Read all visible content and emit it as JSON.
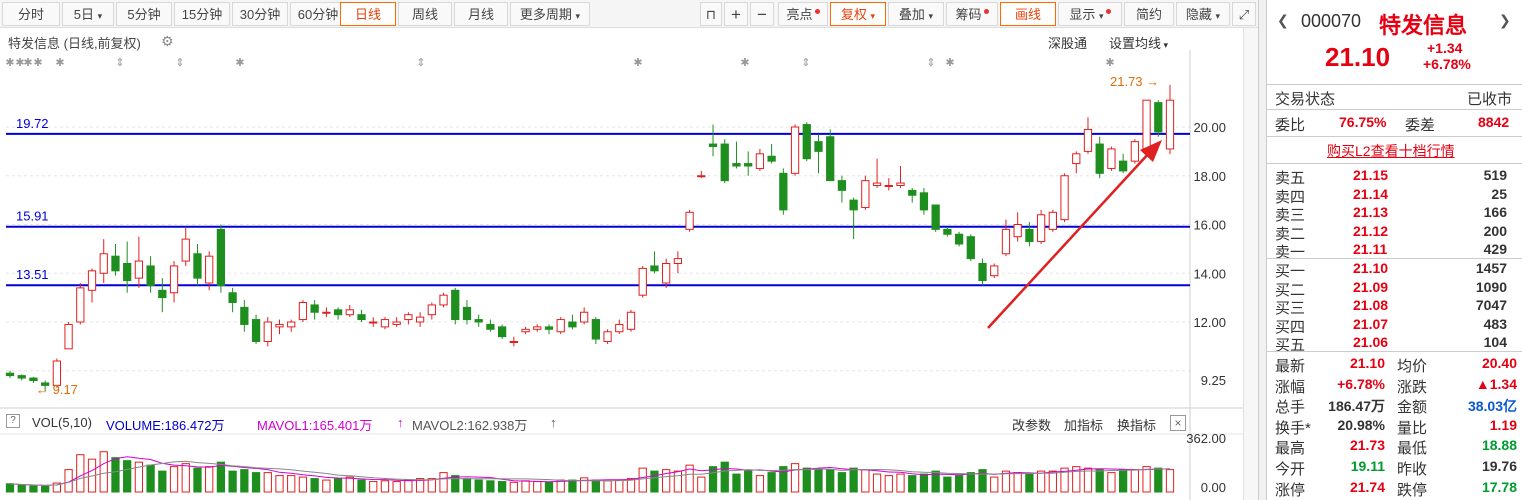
{
  "toolbar": {
    "periods": [
      "分时",
      "5日",
      "5分钟",
      "15分钟",
      "30分钟",
      "60分钟",
      "日线",
      "周线",
      "月线",
      "更多周期"
    ],
    "active_period": "日线",
    "right_tools": [
      "亮点",
      "复权",
      "叠加",
      "筹码",
      "画线",
      "显示",
      "简约",
      "隐藏"
    ]
  },
  "chart": {
    "title": "特发信息 (日线,前复权)",
    "link_sgt": "深股通",
    "link_ma": "设置均线",
    "y_axis_labels": [
      "20.00",
      "18.00",
      "16.00",
      "14.00",
      "12.00"
    ],
    "hlines": [
      {
        "label": "19.72",
        "value": 19.72
      },
      {
        "label": "15.91",
        "value": 15.91
      },
      {
        "label": "13.51",
        "value": 13.51
      }
    ],
    "high_marker": "21.73",
    "low_marker": "9.17",
    "cursor_value": "9.25",
    "colors": {
      "up": "#e02020",
      "down": "#1e8e1e",
      "hline": "#0000dd",
      "arrow": "#e02020",
      "marker": "#e36c09"
    }
  },
  "volume": {
    "indicator": "VOL(5,10)",
    "volume": "VOLUME:186.472万",
    "mavol1": "MAVOL1:165.401万",
    "mavol2": "MAVOL2:162.938万",
    "buttons": [
      "改参数",
      "加指标",
      "换指标"
    ],
    "axis_top": "362.00",
    "axis_bottom": "0.00"
  },
  "quote": {
    "code": "000070",
    "name": "特发信息",
    "price": "21.10",
    "change": "+1.34",
    "change_pct": "+6.78%",
    "status_label": "交易状态",
    "status_value": "已收市",
    "weibi_label": "委比",
    "weibi": "76.75%",
    "weicha_label": "委差",
    "weicha": "8842",
    "l2_link": "购买L2查看十档行情",
    "asks": [
      {
        "label": "卖五",
        "price": "21.15",
        "vol": "519"
      },
      {
        "label": "卖四",
        "price": "21.14",
        "vol": "25"
      },
      {
        "label": "卖三",
        "price": "21.13",
        "vol": "166"
      },
      {
        "label": "卖二",
        "price": "21.12",
        "vol": "200"
      },
      {
        "label": "卖一",
        "price": "21.11",
        "vol": "429"
      }
    ],
    "bids": [
      {
        "label": "买一",
        "price": "21.10",
        "vol": "1457"
      },
      {
        "label": "买二",
        "price": "21.09",
        "vol": "1090"
      },
      {
        "label": "买三",
        "price": "21.08",
        "vol": "7047"
      },
      {
        "label": "买四",
        "price": "21.07",
        "vol": "483"
      },
      {
        "label": "买五",
        "price": "21.06",
        "vol": "104"
      }
    ],
    "stats": [
      {
        "l1": "最新",
        "v1": "21.10",
        "c1": "red",
        "l2": "均价",
        "v2": "20.40",
        "c2": "red"
      },
      {
        "l1": "涨幅",
        "v1": "+6.78%",
        "c1": "red",
        "l2": "涨跌",
        "v2": "▲1.34",
        "c2": "red"
      },
      {
        "l1": "总手",
        "v1": "186.47万",
        "c1": "black",
        "l2": "金额",
        "v2": "38.03亿",
        "c2": "blue"
      },
      {
        "l1": "换手*",
        "v1": "20.98%",
        "c1": "black",
        "l2": "量比",
        "v2": "1.19",
        "c2": "red"
      },
      {
        "l1": "最高",
        "v1": "21.73",
        "c1": "red",
        "l2": "最低",
        "v2": "18.88",
        "c2": "green"
      },
      {
        "l1": "今开",
        "v1": "19.11",
        "c1": "green",
        "l2": "昨收",
        "v2": "19.76",
        "c2": "black"
      },
      {
        "l1": "涨停",
        "v1": "21.74",
        "c1": "red",
        "l2": "跌停",
        "v2": "17.78",
        "c2": "green"
      }
    ]
  },
  "candles": [
    [
      9.9,
      10.0,
      9.7,
      9.8
    ],
    [
      9.8,
      9.85,
      9.6,
      9.7
    ],
    [
      9.7,
      9.75,
      9.5,
      9.6
    ],
    [
      9.5,
      9.6,
      9.17,
      9.4
    ],
    [
      9.4,
      10.5,
      9.3,
      10.4
    ],
    [
      10.9,
      12.0,
      10.9,
      11.9
    ],
    [
      12.0,
      13.6,
      11.9,
      13.4
    ],
    [
      13.3,
      14.2,
      12.8,
      14.1
    ],
    [
      14.0,
      15.4,
      13.6,
      14.8
    ],
    [
      14.7,
      15.2,
      13.9,
      14.1
    ],
    [
      14.4,
      15.3,
      13.2,
      13.7
    ],
    [
      13.8,
      15.5,
      13.4,
      14.5
    ],
    [
      14.3,
      14.7,
      13.2,
      13.5
    ],
    [
      13.3,
      13.8,
      12.4,
      13.0
    ],
    [
      13.2,
      14.5,
      12.8,
      14.3
    ],
    [
      14.5,
      15.9,
      14.3,
      15.4
    ],
    [
      14.8,
      15.2,
      13.5,
      13.8
    ],
    [
      13.6,
      14.9,
      13.3,
      14.7
    ],
    [
      15.8,
      16.0,
      13.2,
      13.5
    ],
    [
      13.2,
      13.4,
      12.4,
      12.8
    ],
    [
      12.6,
      12.9,
      11.6,
      11.9
    ],
    [
      12.1,
      12.3,
      11.1,
      11.2
    ],
    [
      11.2,
      12.2,
      11.0,
      12.0
    ],
    [
      11.8,
      12.1,
      11.5,
      11.9
    ],
    [
      11.8,
      12.1,
      11.6,
      12.0
    ],
    [
      12.1,
      12.9,
      12.0,
      12.8
    ],
    [
      12.7,
      12.9,
      12.1,
      12.4
    ],
    [
      12.4,
      12.6,
      12.2,
      12.4
    ],
    [
      12.5,
      12.6,
      12.1,
      12.3
    ],
    [
      12.3,
      12.7,
      12.2,
      12.5
    ],
    [
      12.3,
      12.5,
      12.0,
      12.1
    ],
    [
      12.0,
      12.2,
      11.8,
      12.0
    ],
    [
      11.8,
      12.2,
      11.7,
      12.1
    ],
    [
      11.9,
      12.2,
      11.8,
      12.0
    ],
    [
      12.1,
      12.4,
      11.9,
      12.3
    ],
    [
      12.0,
      12.4,
      11.8,
      12.2
    ],
    [
      12.3,
      12.8,
      12.1,
      12.7
    ],
    [
      12.7,
      13.2,
      12.6,
      13.1
    ],
    [
      13.3,
      13.4,
      11.9,
      12.1
    ],
    [
      12.6,
      12.9,
      11.9,
      12.1
    ],
    [
      12.1,
      12.3,
      11.8,
      12.0
    ],
    [
      11.9,
      12.1,
      11.6,
      11.7
    ],
    [
      11.8,
      11.9,
      11.3,
      11.4
    ],
    [
      11.2,
      11.4,
      11.0,
      11.2
    ],
    [
      11.6,
      11.8,
      11.5,
      11.7
    ],
    [
      11.7,
      11.9,
      11.6,
      11.8
    ],
    [
      11.8,
      11.9,
      11.5,
      11.7
    ],
    [
      11.6,
      12.2,
      11.5,
      12.1
    ],
    [
      12.0,
      12.3,
      11.7,
      11.8
    ],
    [
      12.0,
      12.6,
      11.9,
      12.4
    ],
    [
      12.1,
      12.2,
      11.1,
      11.3
    ],
    [
      11.2,
      11.7,
      11.1,
      11.6
    ],
    [
      11.6,
      12.1,
      11.5,
      11.9
    ],
    [
      11.7,
      12.5,
      11.6,
      12.4
    ],
    [
      13.1,
      14.3,
      13.0,
      14.2
    ],
    [
      14.3,
      14.9,
      14.0,
      14.1
    ],
    [
      13.6,
      14.6,
      13.4,
      14.4
    ],
    [
      14.4,
      14.9,
      14.0,
      14.6
    ],
    [
      15.8,
      16.6,
      15.7,
      16.5
    ],
    [
      18.0,
      18.2,
      17.9,
      18.0
    ],
    [
      19.3,
      20.1,
      18.8,
      19.2
    ],
    [
      19.3,
      19.5,
      17.7,
      17.8
    ],
    [
      18.5,
      19.4,
      18.3,
      18.4
    ],
    [
      18.5,
      19.0,
      18.0,
      18.4
    ],
    [
      18.3,
      19.1,
      18.2,
      18.9
    ],
    [
      18.8,
      19.3,
      18.5,
      18.6
    ],
    [
      18.1,
      18.3,
      16.4,
      16.6
    ],
    [
      18.1,
      20.1,
      18.0,
      20.0
    ],
    [
      20.1,
      20.2,
      18.6,
      18.7
    ],
    [
      19.4,
      19.7,
      18.1,
      19.0
    ],
    [
      19.6,
      19.9,
      17.8,
      17.8
    ],
    [
      17.8,
      18.0,
      16.9,
      17.4
    ],
    [
      17.0,
      17.1,
      15.4,
      16.6
    ],
    [
      16.7,
      18.0,
      16.6,
      17.8
    ],
    [
      17.6,
      18.7,
      17.5,
      17.7
    ],
    [
      17.6,
      17.9,
      17.4,
      17.6
    ],
    [
      17.6,
      18.4,
      17.5,
      17.7
    ],
    [
      17.4,
      17.5,
      16.9,
      17.2
    ],
    [
      17.3,
      17.5,
      16.4,
      16.6
    ],
    [
      16.8,
      16.8,
      15.7,
      15.8
    ],
    [
      15.8,
      15.9,
      15.5,
      15.6
    ],
    [
      15.6,
      15.7,
      15.1,
      15.2
    ],
    [
      15.5,
      15.6,
      14.5,
      14.6
    ],
    [
      14.4,
      14.6,
      13.5,
      13.7
    ],
    [
      13.9,
      14.4,
      13.8,
      14.3
    ],
    [
      14.8,
      16.2,
      14.7,
      15.8
    ],
    [
      15.5,
      16.5,
      15.3,
      16.0
    ],
    [
      15.8,
      16.1,
      15.1,
      15.3
    ],
    [
      15.3,
      16.6,
      15.2,
      16.4
    ],
    [
      15.8,
      16.6,
      15.7,
      16.5
    ],
    [
      16.2,
      18.1,
      16.1,
      18.0
    ],
    [
      18.5,
      19.0,
      18.1,
      18.9
    ],
    [
      19.0,
      20.4,
      18.9,
      19.9
    ],
    [
      19.3,
      19.6,
      17.9,
      18.1
    ],
    [
      18.3,
      19.2,
      18.2,
      19.1
    ],
    [
      18.6,
      18.9,
      18.1,
      18.2
    ],
    [
      18.6,
      19.5,
      18.5,
      19.4
    ],
    [
      19.1,
      21.1,
      18.8,
      21.1
    ],
    [
      21.0,
      21.1,
      19.6,
      19.8
    ],
    [
      19.1,
      21.73,
      18.88,
      21.1
    ]
  ],
  "vols": [
    55,
    45,
    40,
    38,
    60,
    150,
    250,
    220,
    270,
    230,
    210,
    200,
    180,
    140,
    170,
    190,
    160,
    170,
    200,
    140,
    150,
    130,
    130,
    110,
    110,
    100,
    90,
    80,
    90,
    100,
    80,
    70,
    75,
    70,
    80,
    90,
    90,
    130,
    110,
    90,
    80,
    75,
    70,
    65,
    75,
    70,
    65,
    80,
    80,
    95,
    80,
    75,
    80,
    90,
    160,
    140,
    150,
    140,
    180,
    100,
    170,
    200,
    120,
    140,
    110,
    130,
    170,
    190,
    160,
    150,
    150,
    130,
    160,
    150,
    120,
    110,
    120,
    110,
    120,
    140,
    100,
    110,
    130,
    150,
    100,
    140,
    130,
    120,
    140,
    140,
    160,
    170,
    160,
    150,
    130,
    150,
    150,
    170,
    160,
    150
  ]
}
